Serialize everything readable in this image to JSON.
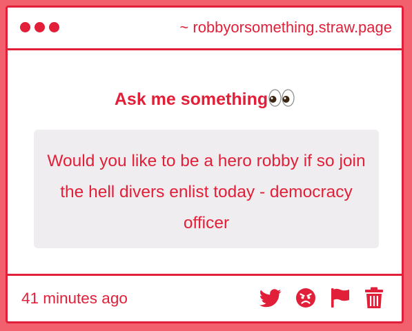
{
  "window": {
    "url": "~ robbyorsomething.straw.page"
  },
  "main": {
    "heading": "Ask me something",
    "heading_emoji": "eyes-emoji",
    "question": "Would you like to be a hero robby if so join the hell divers enlist today - democracy officer"
  },
  "footer": {
    "timestamp": "41 minutes ago",
    "actions": [
      {
        "icon": "twitter-icon"
      },
      {
        "icon": "angry-face-icon"
      },
      {
        "icon": "flag-icon"
      },
      {
        "icon": "trash-icon"
      }
    ]
  },
  "colors": {
    "accent": "#e11f38",
    "background": "#f2606e",
    "card": "#ffffff",
    "question_box": "#efedef"
  }
}
